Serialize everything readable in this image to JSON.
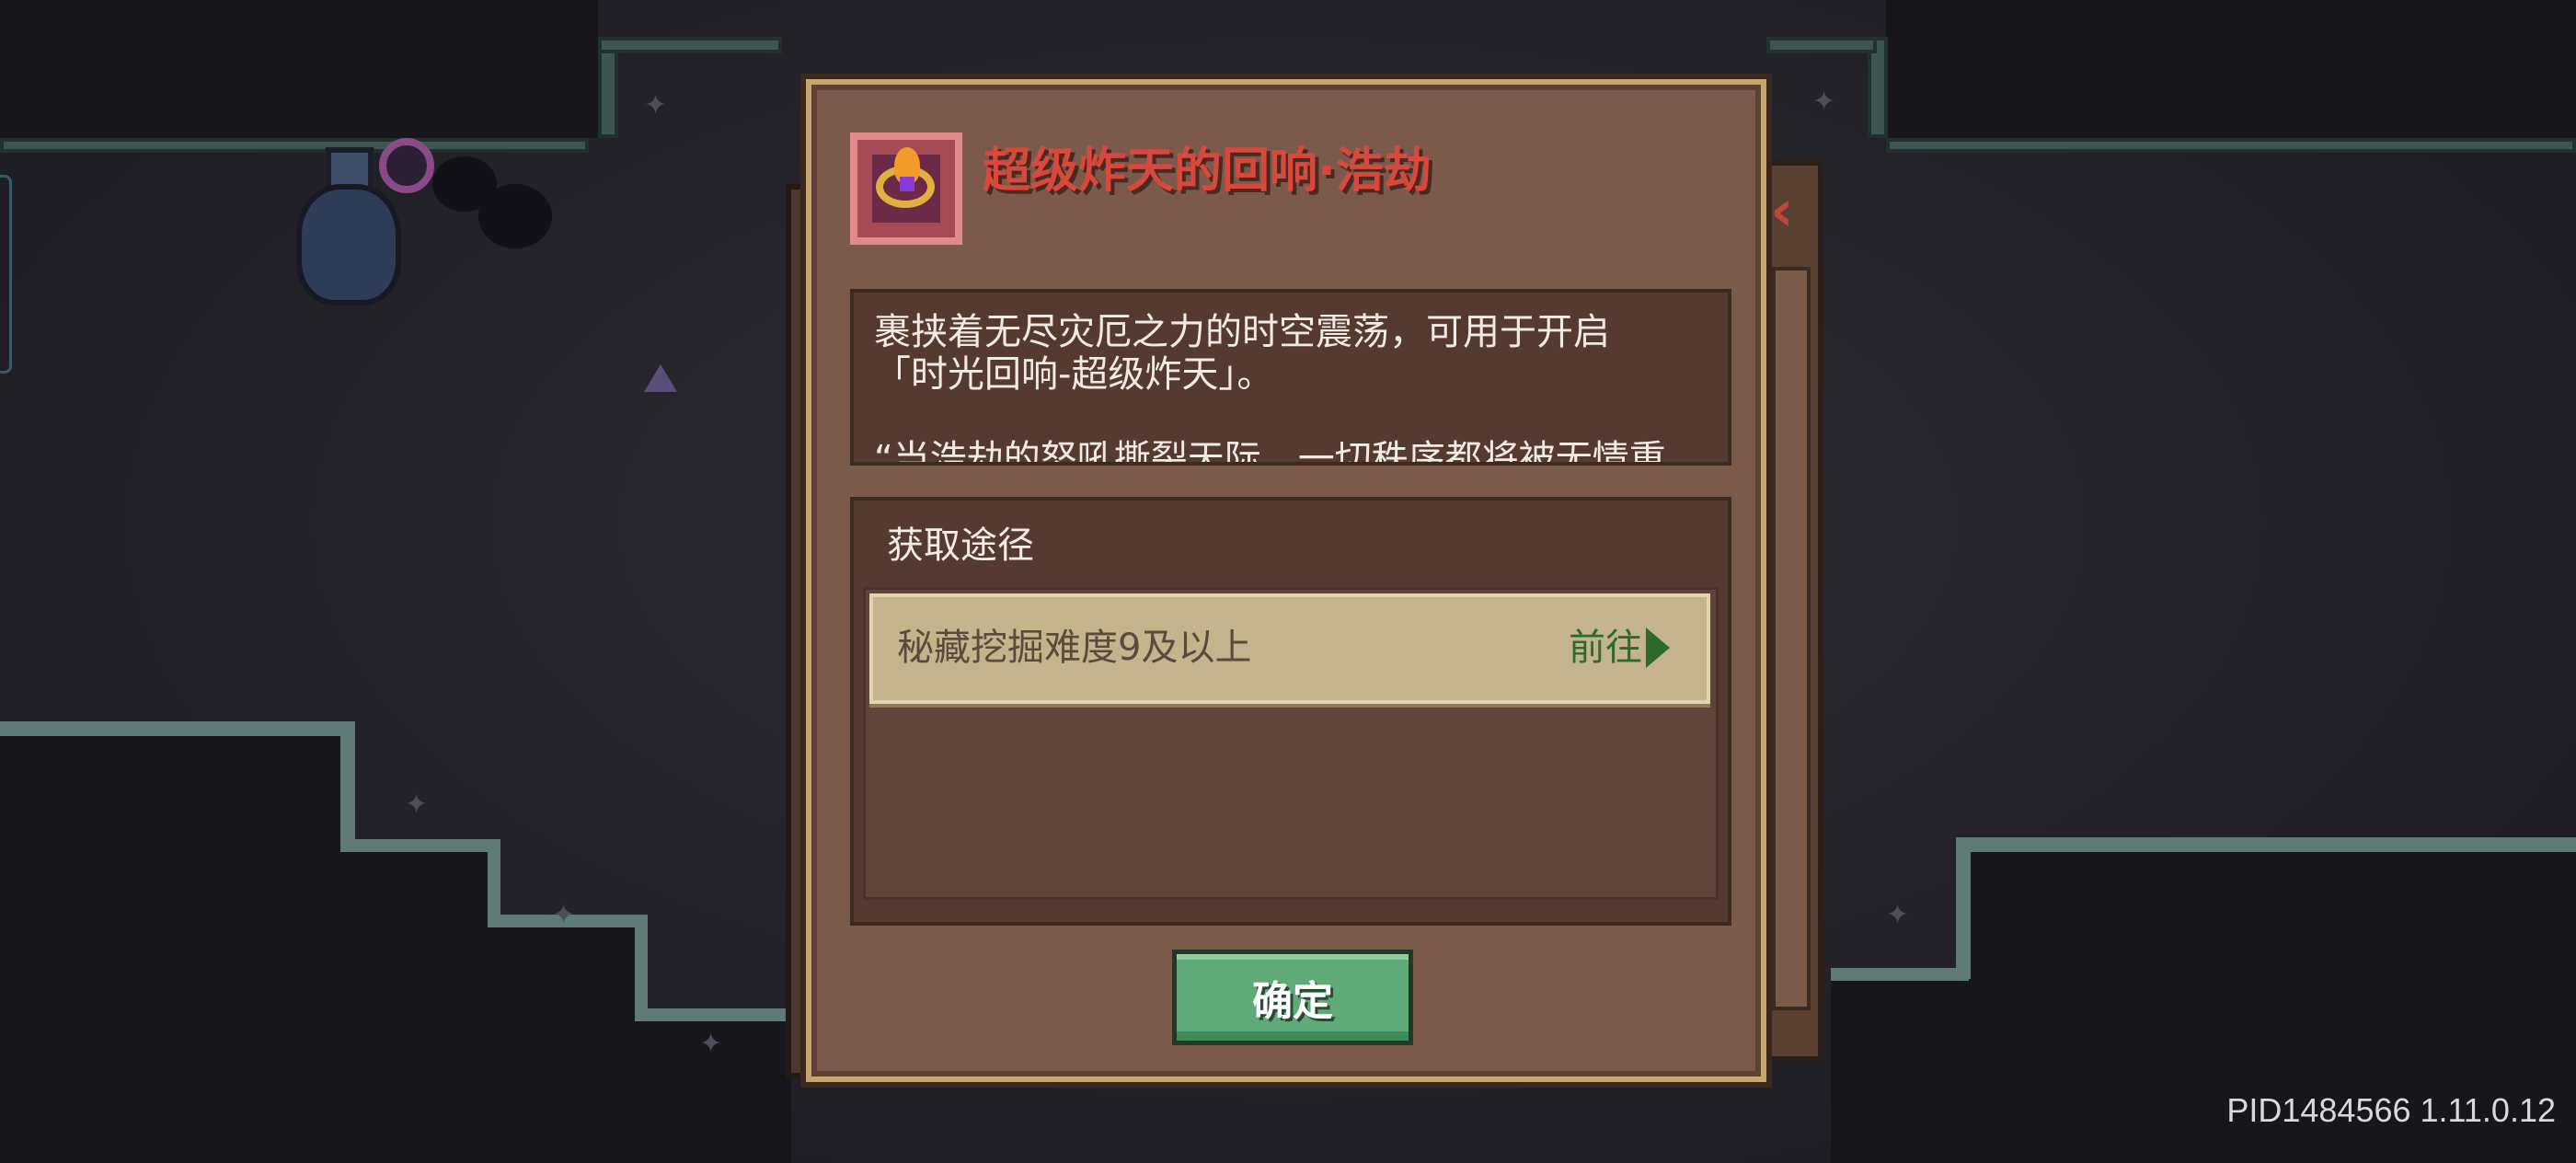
{
  "dialog": {
    "title": "超级炸天的回响·浩劫",
    "item_icon": "echo-orb-icon",
    "description": "裹挟着无尽灾厄之力的时空震荡，可用于开启\n「时光回响-超级炸天」。\n\n“当浩劫的怒吼撕裂天际，一切秩序都将被无情重",
    "source_section": {
      "title": "获取途径",
      "entries": [
        {
          "label": "秘藏挖掘难度9及以上",
          "action_label": "前往"
        }
      ]
    },
    "confirm_label": "确定"
  },
  "footer": {
    "version_text": "PID1484566 1.11.0.12"
  },
  "colors": {
    "title": "#d8483c",
    "confirm": "#5eaa78",
    "go_text": "#2e6a2c"
  }
}
